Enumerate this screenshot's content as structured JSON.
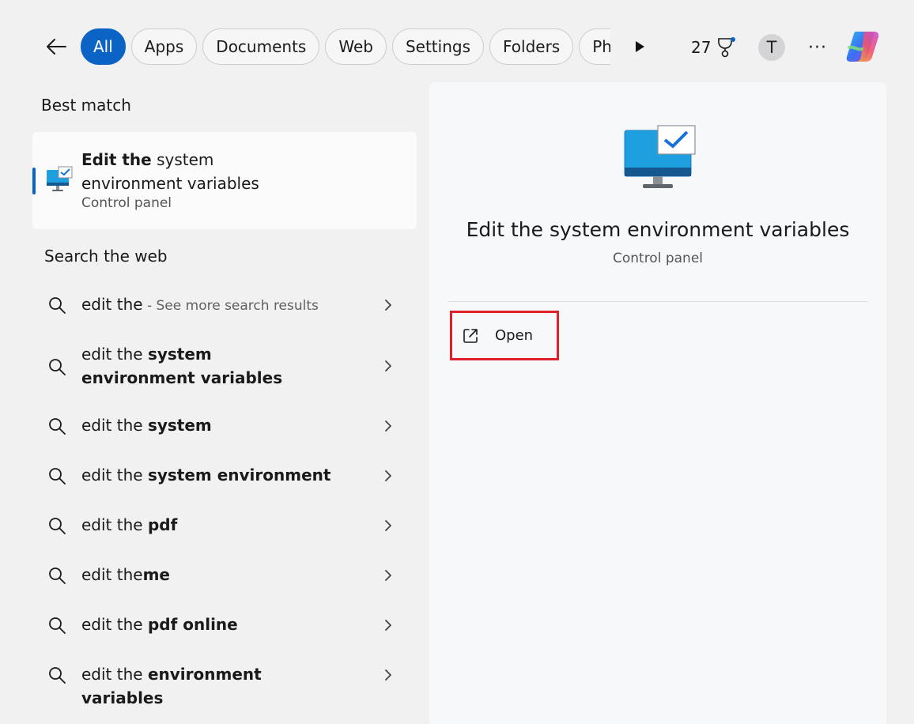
{
  "topbar": {
    "tabs": [
      {
        "label": "All",
        "active": true
      },
      {
        "label": "Apps"
      },
      {
        "label": "Documents"
      },
      {
        "label": "Web"
      },
      {
        "label": "Settings"
      },
      {
        "label": "Folders"
      },
      {
        "label": "Pho"
      }
    ],
    "points": "27",
    "avatar_initial": "T",
    "more_label": "···"
  },
  "best_match": {
    "heading": "Best match",
    "title_bold": "Edit the",
    "title_rest": " system environment variables",
    "subtitle": "Control panel"
  },
  "web": {
    "heading": "Search the web",
    "results": [
      {
        "prefix": "edit the",
        "bold": "",
        "hint": " - See more search results"
      },
      {
        "prefix": "edit the ",
        "bold": "system environment variables",
        "hint": ""
      },
      {
        "prefix": "edit the ",
        "bold": "system",
        "hint": ""
      },
      {
        "prefix": "edit the ",
        "bold": "system environment",
        "hint": ""
      },
      {
        "prefix": "edit the ",
        "bold": "pdf",
        "hint": ""
      },
      {
        "prefix": "edit the",
        "bold": "me",
        "hint": ""
      },
      {
        "prefix": "edit the ",
        "bold": "pdf online",
        "hint": ""
      },
      {
        "prefix": "edit the ",
        "bold": "environment variables",
        "hint": ""
      }
    ]
  },
  "preview": {
    "title": "Edit the system environment variables",
    "subtitle": "Control panel",
    "open_label": "Open"
  },
  "colors": {
    "accent": "#0b63c6",
    "highlight_box": "#e0202a"
  }
}
